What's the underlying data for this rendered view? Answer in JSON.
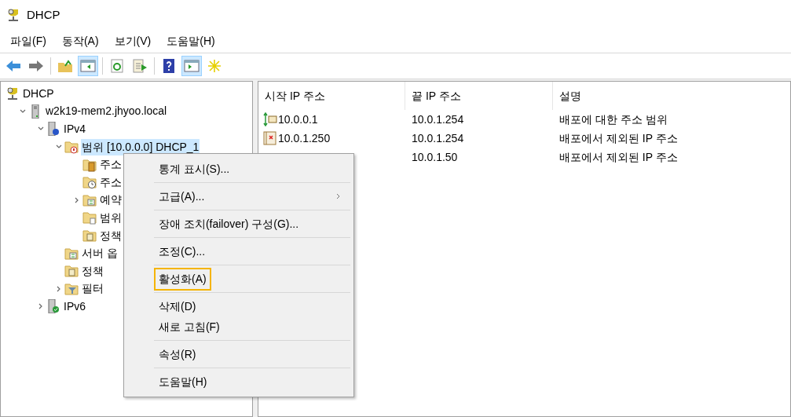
{
  "window": {
    "title": "DHCP"
  },
  "menu_bar": [
    "파일(F)",
    "동작(A)",
    "보기(V)",
    "도움말(H)"
  ],
  "toolbar": [
    {
      "kind": "back",
      "pressed": false
    },
    {
      "kind": "forward",
      "pressed": false
    },
    {
      "kind": "separator"
    },
    {
      "kind": "up",
      "pressed": false
    },
    {
      "kind": "tree",
      "pressed": true
    },
    {
      "kind": "separator"
    },
    {
      "kind": "refresh",
      "pressed": false
    },
    {
      "kind": "export",
      "pressed": false
    },
    {
      "kind": "separator"
    },
    {
      "kind": "help",
      "pressed": false
    },
    {
      "kind": "pane",
      "pressed": true
    },
    {
      "kind": "star",
      "pressed": false
    }
  ],
  "tree": [
    {
      "label": "DHCP",
      "kind": "root",
      "selected": false,
      "children": [
        {
          "label": "w2k19-mem2.jhyoo.local",
          "kind": "server",
          "selected": false,
          "expanded": true,
          "children": [
            {
              "label": "IPv4",
              "kind": "ipv4",
              "selected": false,
              "expanded": true,
              "children": [
                {
                  "label": "범위 [10.0.0.0] DHCP_1",
                  "kind": "scope",
                  "selected": true,
                  "expanded": true,
                  "children": [
                    {
                      "label": "주소",
                      "kind": "pool",
                      "selected": false
                    },
                    {
                      "label": "주소",
                      "kind": "leases",
                      "selected": false
                    },
                    {
                      "label": "예약",
                      "kind": "options",
                      "selected": false,
                      "expanded": false
                    },
                    {
                      "label": "범위",
                      "kind": "scope-options",
                      "selected": false
                    },
                    {
                      "label": "정책",
                      "kind": "policies",
                      "selected": false
                    }
                  ]
                },
                {
                  "label": "서버 옵",
                  "kind": "options",
                  "selected": false
                },
                {
                  "label": "정책",
                  "kind": "policies",
                  "selected": false
                },
                {
                  "label": "필터",
                  "kind": "filters",
                  "selected": false,
                  "expanded": false
                }
              ]
            },
            {
              "label": "IPv6",
              "kind": "ipv6",
              "selected": false,
              "expanded": false
            }
          ]
        }
      ]
    }
  ],
  "table": {
    "columns": [
      "시작 IP 주소",
      "끝 IP 주소",
      "설명"
    ],
    "rows": [
      {
        "kind": "range",
        "start": "10.0.0.1",
        "end": "10.0.1.254",
        "description": "배포에 대한 주소 범위"
      },
      {
        "kind": "excluded",
        "start": "10.0.1.250",
        "end": "10.0.1.254",
        "description": "배포에서 제외된 IP 주소"
      },
      {
        "end": "10.0.1.50",
        "description": "배포에서 제외된 IP 주소"
      }
    ]
  },
  "context_menu": {
    "groups": [
      [
        {
          "label": "통계 표시(S)...",
          "submenu": false,
          "highlighted": false
        }
      ],
      [
        {
          "label": "고급(A)...",
          "submenu": true,
          "highlighted": false
        }
      ],
      [
        {
          "label": "장애 조치(failover) 구성(G)...",
          "submenu": false,
          "highlighted": false
        }
      ],
      [
        {
          "label": "조정(C)...",
          "submenu": false,
          "highlighted": false
        }
      ],
      [
        {
          "label": "활성화(A)",
          "submenu": false,
          "highlighted": true
        }
      ],
      [
        {
          "label": "삭제(D)",
          "submenu": false,
          "highlighted": false
        },
        {
          "label": "새로 고침(F)",
          "submenu": false,
          "highlighted": false
        }
      ],
      [
        {
          "label": "속성(R)",
          "submenu": false,
          "highlighted": false
        }
      ],
      [
        {
          "label": "도움말(H)",
          "submenu": false,
          "highlighted": false
        }
      ]
    ]
  }
}
